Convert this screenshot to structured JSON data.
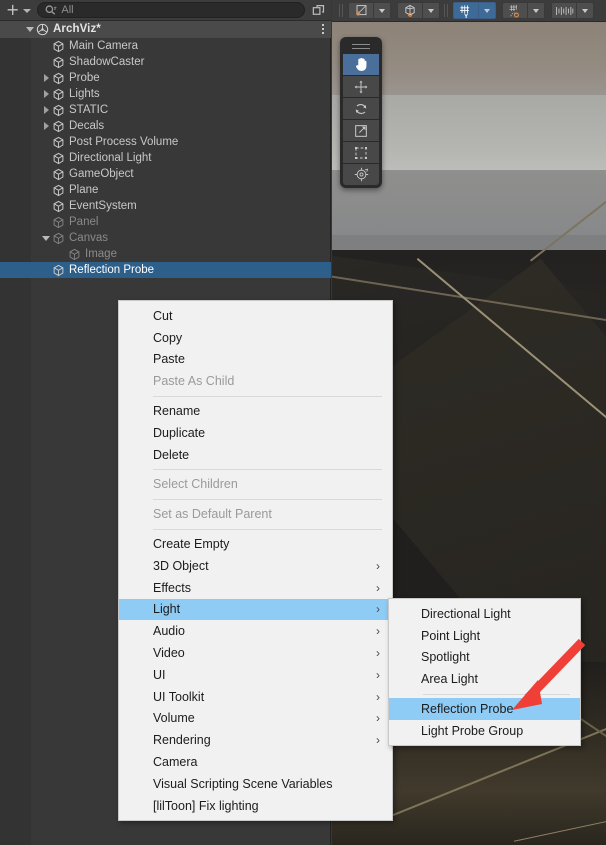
{
  "app": {
    "accent_selection": "#2d5f8b",
    "menu_highlight": "#8ecbf5",
    "annotation_color": "#ef3f36"
  },
  "hierarchy": {
    "toolbar": {
      "create_label": "+",
      "create_icon": "plus-icon",
      "create_dropdown_icon": "chevron-down-icon",
      "search_icon": "search-icon",
      "search_value": "",
      "search_placeholder": "All",
      "popout_icon": "popout-window-icon"
    },
    "scene": {
      "name": "ArchViz*",
      "icon": "unity-scene-icon",
      "expanded": true,
      "options_icon": "kebab-menu-icon"
    },
    "items": [
      {
        "label": "Main Camera",
        "icon": "cube-icon",
        "depth": 1,
        "foldout": "none",
        "dim": false,
        "selected": false
      },
      {
        "label": "ShadowCaster",
        "icon": "cube-icon",
        "depth": 1,
        "foldout": "none",
        "dim": false,
        "selected": false
      },
      {
        "label": "Probe",
        "icon": "cube-icon",
        "depth": 1,
        "foldout": "closed",
        "dim": false,
        "selected": false
      },
      {
        "label": "Lights",
        "icon": "cube-icon",
        "depth": 1,
        "foldout": "closed",
        "dim": false,
        "selected": false
      },
      {
        "label": "STATIC",
        "icon": "cube-icon",
        "depth": 1,
        "foldout": "closed",
        "dim": false,
        "selected": false
      },
      {
        "label": "Decals",
        "icon": "cube-icon",
        "depth": 1,
        "foldout": "closed",
        "dim": false,
        "selected": false
      },
      {
        "label": "Post Process Volume",
        "icon": "cube-icon",
        "depth": 1,
        "foldout": "none",
        "dim": false,
        "selected": false
      },
      {
        "label": "Directional Light",
        "icon": "cube-icon",
        "depth": 1,
        "foldout": "none",
        "dim": false,
        "selected": false
      },
      {
        "label": "GameObject",
        "icon": "cube-icon",
        "depth": 1,
        "foldout": "none",
        "dim": false,
        "selected": false
      },
      {
        "label": "Plane",
        "icon": "cube-icon",
        "depth": 1,
        "foldout": "none",
        "dim": false,
        "selected": false
      },
      {
        "label": "EventSystem",
        "icon": "cube-icon",
        "depth": 1,
        "foldout": "none",
        "dim": false,
        "selected": false
      },
      {
        "label": "Panel",
        "icon": "cube-icon",
        "depth": 1,
        "foldout": "none",
        "dim": true,
        "selected": false
      },
      {
        "label": "Canvas",
        "icon": "cube-icon",
        "depth": 1,
        "foldout": "open",
        "dim": true,
        "selected": false
      },
      {
        "label": "Image",
        "icon": "cube-icon",
        "depth": 2,
        "foldout": "none",
        "dim": true,
        "selected": false
      },
      {
        "label": "Reflection Probe",
        "icon": "cube-icon",
        "depth": 1,
        "foldout": "none",
        "dim": false,
        "selected": true
      }
    ]
  },
  "scene_view": {
    "toolbar": [
      {
        "name": "pivot-rotation-toggle",
        "icon": "pivot-center-icon",
        "active": false,
        "has_dropdown": true
      },
      {
        "name": "handle-space-toggle",
        "icon": "global-handle-icon",
        "active": false,
        "has_dropdown": true
      },
      {
        "name": "grid-snapping-toggle",
        "icon": "grid-snap-icon",
        "active": true,
        "has_dropdown": true
      },
      {
        "name": "surface-snap-toggle",
        "icon": "surface-snap-icon",
        "active": false,
        "has_dropdown": true
      },
      {
        "name": "increment-snap-toggle",
        "icon": "increment-snap-icon",
        "active": false,
        "has_dropdown": true
      }
    ],
    "tools": [
      {
        "name": "view-tool",
        "icon": "hand-icon",
        "active": true
      },
      {
        "name": "move-tool",
        "icon": "move-arrows-icon",
        "active": false
      },
      {
        "name": "rotate-tool",
        "icon": "rotate-icon",
        "active": false
      },
      {
        "name": "scale-tool",
        "icon": "scale-icon",
        "active": false
      },
      {
        "name": "rect-tool",
        "icon": "rect-transform-icon",
        "active": false
      },
      {
        "name": "transform-tool",
        "icon": "transform-gizmo-icon",
        "active": false
      }
    ],
    "tools_grip_icon": "drag-handle-icon"
  },
  "context_menu": {
    "items": [
      {
        "label": "Cut",
        "disabled": false,
        "submenu": false,
        "highlighted": false,
        "sep_after": false
      },
      {
        "label": "Copy",
        "disabled": false,
        "submenu": false,
        "highlighted": false,
        "sep_after": false
      },
      {
        "label": "Paste",
        "disabled": false,
        "submenu": false,
        "highlighted": false,
        "sep_after": false
      },
      {
        "label": "Paste As Child",
        "disabled": true,
        "submenu": false,
        "highlighted": false,
        "sep_after": true
      },
      {
        "label": "Rename",
        "disabled": false,
        "submenu": false,
        "highlighted": false,
        "sep_after": false
      },
      {
        "label": "Duplicate",
        "disabled": false,
        "submenu": false,
        "highlighted": false,
        "sep_after": false
      },
      {
        "label": "Delete",
        "disabled": false,
        "submenu": false,
        "highlighted": false,
        "sep_after": true
      },
      {
        "label": "Select Children",
        "disabled": true,
        "submenu": false,
        "highlighted": false,
        "sep_after": true
      },
      {
        "label": "Set as Default Parent",
        "disabled": true,
        "submenu": false,
        "highlighted": false,
        "sep_after": true
      },
      {
        "label": "Create Empty",
        "disabled": false,
        "submenu": false,
        "highlighted": false,
        "sep_after": false
      },
      {
        "label": "3D Object",
        "disabled": false,
        "submenu": true,
        "highlighted": false,
        "sep_after": false
      },
      {
        "label": "Effects",
        "disabled": false,
        "submenu": true,
        "highlighted": false,
        "sep_after": false
      },
      {
        "label": "Light",
        "disabled": false,
        "submenu": true,
        "highlighted": true,
        "sep_after": false
      },
      {
        "label": "Audio",
        "disabled": false,
        "submenu": true,
        "highlighted": false,
        "sep_after": false
      },
      {
        "label": "Video",
        "disabled": false,
        "submenu": true,
        "highlighted": false,
        "sep_after": false
      },
      {
        "label": "UI",
        "disabled": false,
        "submenu": true,
        "highlighted": false,
        "sep_after": false
      },
      {
        "label": "UI Toolkit",
        "disabled": false,
        "submenu": true,
        "highlighted": false,
        "sep_after": false
      },
      {
        "label": "Volume",
        "disabled": false,
        "submenu": true,
        "highlighted": false,
        "sep_after": false
      },
      {
        "label": "Rendering",
        "disabled": false,
        "submenu": true,
        "highlighted": false,
        "sep_after": false
      },
      {
        "label": "Camera",
        "disabled": false,
        "submenu": false,
        "highlighted": false,
        "sep_after": false
      },
      {
        "label": "Visual Scripting Scene Variables",
        "disabled": false,
        "submenu": false,
        "highlighted": false,
        "sep_after": false
      },
      {
        "label": "[lilToon] Fix lighting",
        "disabled": false,
        "submenu": false,
        "highlighted": false,
        "sep_after": false
      }
    ],
    "submenu_arrow_glyph": "›"
  },
  "light_submenu": {
    "items": [
      {
        "label": "Directional Light",
        "highlighted": false,
        "sep_after": false
      },
      {
        "label": "Point Light",
        "highlighted": false,
        "sep_after": false
      },
      {
        "label": "Spotlight",
        "highlighted": false,
        "sep_after": false
      },
      {
        "label": "Area Light",
        "highlighted": false,
        "sep_after": true
      },
      {
        "label": "Reflection Probe",
        "highlighted": true,
        "sep_after": false
      },
      {
        "label": "Light Probe Group",
        "highlighted": false,
        "sep_after": false
      }
    ]
  },
  "annotation": {
    "icon": "red-arrow-pointer",
    "points_to": "Reflection Probe"
  }
}
